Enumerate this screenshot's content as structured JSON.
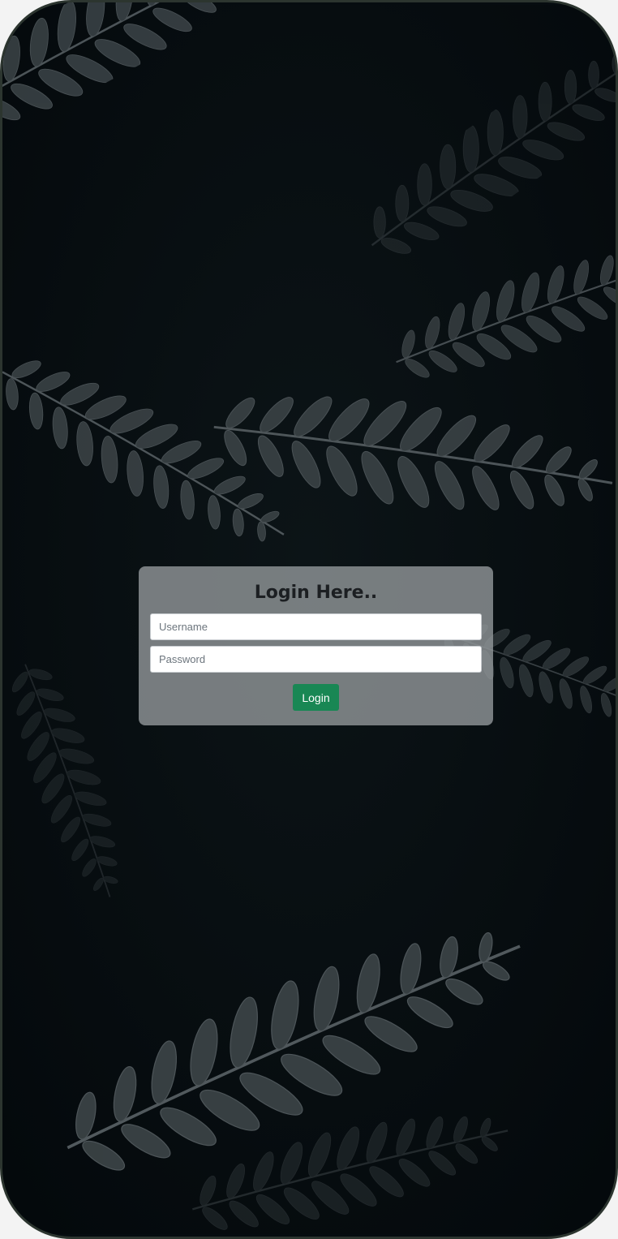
{
  "login_form": {
    "title": "Login Here..",
    "username_placeholder": "Username",
    "password_placeholder": "Password",
    "submit_label": "Login"
  },
  "colors": {
    "background": "#060c10",
    "card": "#969b9d",
    "button": "#198754",
    "frame_border": "#2c352f"
  },
  "icons": {
    "background": "fern-leaves-background"
  }
}
